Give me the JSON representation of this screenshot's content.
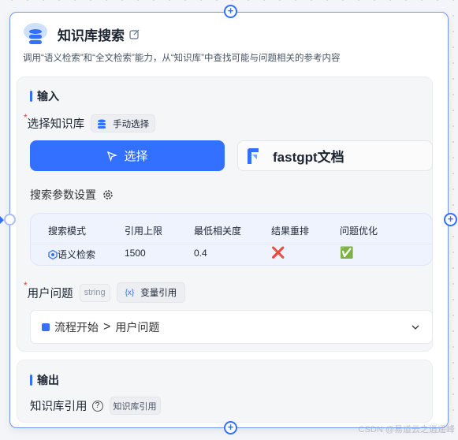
{
  "node": {
    "title": "知识库搜索",
    "description": "调用“语义检索”和“全文检索”能力，从“知识库”中查找可能与问题相关的参考内容"
  },
  "input": {
    "section_title": "输入",
    "kb": {
      "label": "选择知识库",
      "mode_chip": "手动选择",
      "select_button": "选择",
      "selected": "fastgpt文档"
    },
    "params": {
      "label": "搜索参数设置",
      "headers": [
        "搜索模式",
        "引用上限",
        "最低相关度",
        "结果重排",
        "问题优化"
      ],
      "values": {
        "mode": "语义检索",
        "limit": "1500",
        "similarity": "0.4",
        "rerank": "❌",
        "optimize": "✅"
      }
    },
    "question": {
      "label": "用户问题",
      "type_chip": "string",
      "ref_chip": "变量引用",
      "ref_icon": "{x}",
      "path_node": "流程开始",
      "path_sep": ">",
      "path_field": "用户问题"
    }
  },
  "output": {
    "section_title": "输出",
    "label": "知识库引用",
    "chip": "知识库引用"
  },
  "watermark": "CSDN @易道云之逍遥峰",
  "colors": {
    "accent": "#3370ff",
    "border": "#6f95f7"
  }
}
